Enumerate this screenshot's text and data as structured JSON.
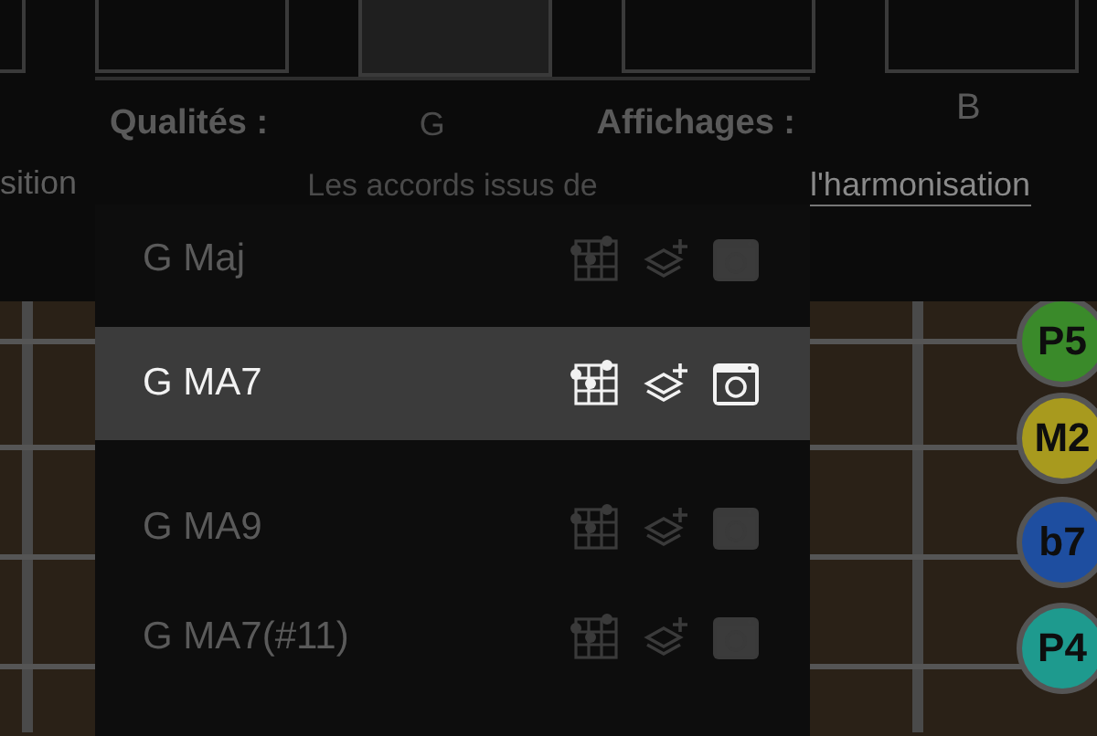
{
  "top_tabs": [
    {
      "selected": false
    },
    {
      "selected": false
    },
    {
      "selected": true
    },
    {
      "selected": false
    },
    {
      "selected": false
    }
  ],
  "headers": {
    "qualities": "Qualités :",
    "root": "G",
    "displays": "Affichages :",
    "note": "B"
  },
  "description": {
    "left": "sition",
    "middle": "Les accords issus de",
    "link": "l'harmonisation"
  },
  "chords": [
    {
      "label": "G Maj",
      "selected": false
    },
    {
      "label": "G MA7",
      "selected": true
    },
    {
      "label": "G MA9",
      "selected": false
    },
    {
      "label": "G MA7(#11)",
      "selected": false
    }
  ],
  "intervals": [
    {
      "label": "P5",
      "color": "#3a8a2a"
    },
    {
      "label": "M2",
      "color": "#a89a1e"
    },
    {
      "label": "b7",
      "color": "#1e4ea0"
    },
    {
      "label": "P4",
      "color": "#1e9a8e"
    }
  ]
}
